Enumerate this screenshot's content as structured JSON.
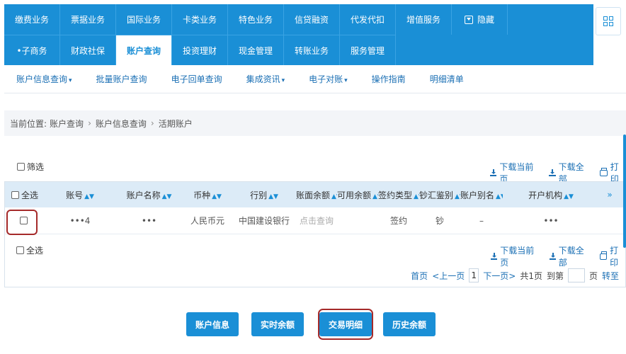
{
  "topnav": {
    "row1": [
      "缴费业务",
      "票据业务",
      "国际业务",
      "卡类业务",
      "特色业务",
      "信贷融资",
      "代发代扣",
      "增值服务"
    ],
    "hide_label": "隐藏",
    "row2": [
      "•子商务",
      "财政社保",
      "账户查询",
      "投资理财",
      "现金管理",
      "转账业务",
      "服务管理"
    ],
    "active_index": 2
  },
  "subnav": {
    "items": [
      {
        "label": "账户信息查询",
        "caret": true
      },
      {
        "label": "批量账户查询",
        "caret": false
      },
      {
        "label": "电子回单查询",
        "caret": false
      },
      {
        "label": "集成资讯",
        "caret": true
      },
      {
        "label": "电子对账",
        "caret": true
      },
      {
        "label": "操作指南",
        "caret": false
      },
      {
        "label": "明细清单",
        "caret": false
      }
    ]
  },
  "breadcrumb": {
    "prefix": "当前位置:",
    "parts": [
      "账户查询",
      "账户信息查询",
      "活期账户"
    ]
  },
  "filter": {
    "label": "筛选"
  },
  "actions": {
    "download_page": "下载当前页",
    "download_all": "下载全部",
    "print": "打印"
  },
  "table": {
    "select_all": "全选",
    "columns": [
      "账号",
      "账户名称",
      "币种",
      "行别",
      "账面余额",
      "可用余额",
      "签约类型",
      "钞汇鉴别",
      "账户别名",
      "开户机构"
    ],
    "rows": [
      {
        "account": "•••4",
        "name": "•••",
        "currency": "人民币元",
        "bank": "中国建设银行",
        "book_balance": "点击查询",
        "available": "",
        "sign_type": "签约",
        "cash_flag": "钞",
        "alias": "–",
        "branch": "•••"
      }
    ]
  },
  "footer": {
    "select_all": "全选"
  },
  "pager": {
    "first": "首页",
    "prev": "<上一页",
    "current": "1",
    "next": "下一页>",
    "total": "共1页",
    "goto_prefix": "到第",
    "goto_suffix": "页",
    "go": "转至"
  },
  "buttons": {
    "account_info": "账户信息",
    "realtime_balance": "实时余额",
    "transaction_detail": "交易明细",
    "history_balance": "历史余额"
  }
}
